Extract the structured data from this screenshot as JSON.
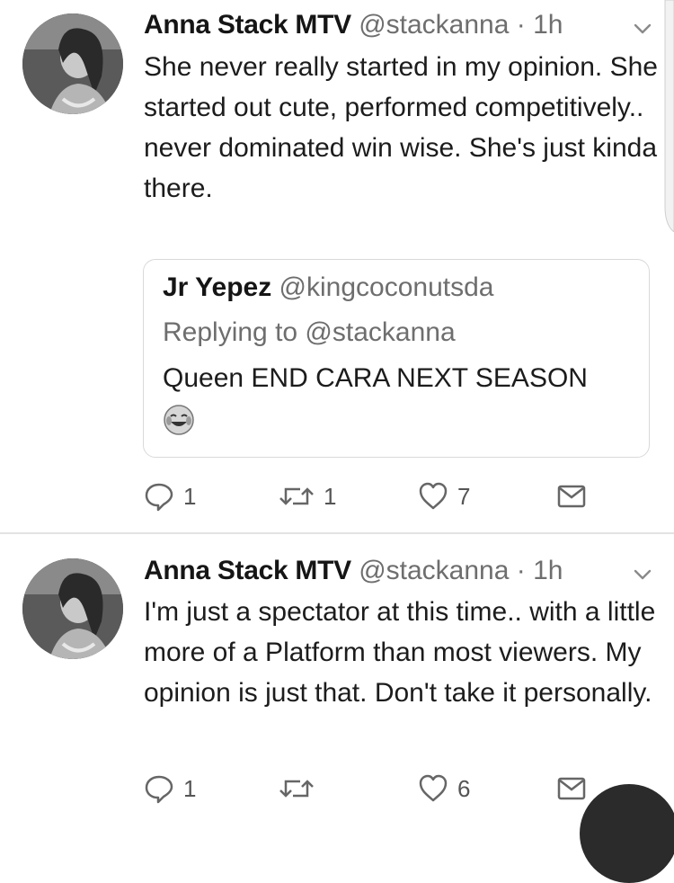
{
  "tweets": [
    {
      "author": "Anna Stack MTV",
      "handle": "@stackanna",
      "time": "· 1h",
      "text": "She never really started in my opinion. She started out cute, performed competitively.. never dominated win wise. She's just kinda there.",
      "quoted": {
        "author": "Jr Yepez",
        "handle": "@kingcoconutsda",
        "replying_to": "Replying to @stackanna",
        "text": "Queen END CARA NEXT SEASON",
        "emoji": "face-with-tears-of-joy-icon"
      },
      "actions": {
        "replies": "1",
        "retweets": "1",
        "likes": "7"
      }
    },
    {
      "author": "Anna Stack MTV",
      "handle": "@stackanna",
      "time": "· 1h",
      "text": "I'm just a spectator at this time.. with a little more of a Platform than most viewers. My opinion is just that. Don't take it personally.",
      "actions": {
        "replies": "1",
        "retweets": "",
        "likes": "6"
      }
    }
  ],
  "icons": {
    "reply": "reply-icon",
    "retweet": "retweet-icon",
    "like": "heart-icon",
    "message": "envelope-icon",
    "menu": "chevron-down-icon"
  },
  "colors": {
    "text": "#1a1a1a",
    "muted": "#6e6e6e",
    "border": "#d9d9d9",
    "background": "#ffffff"
  }
}
